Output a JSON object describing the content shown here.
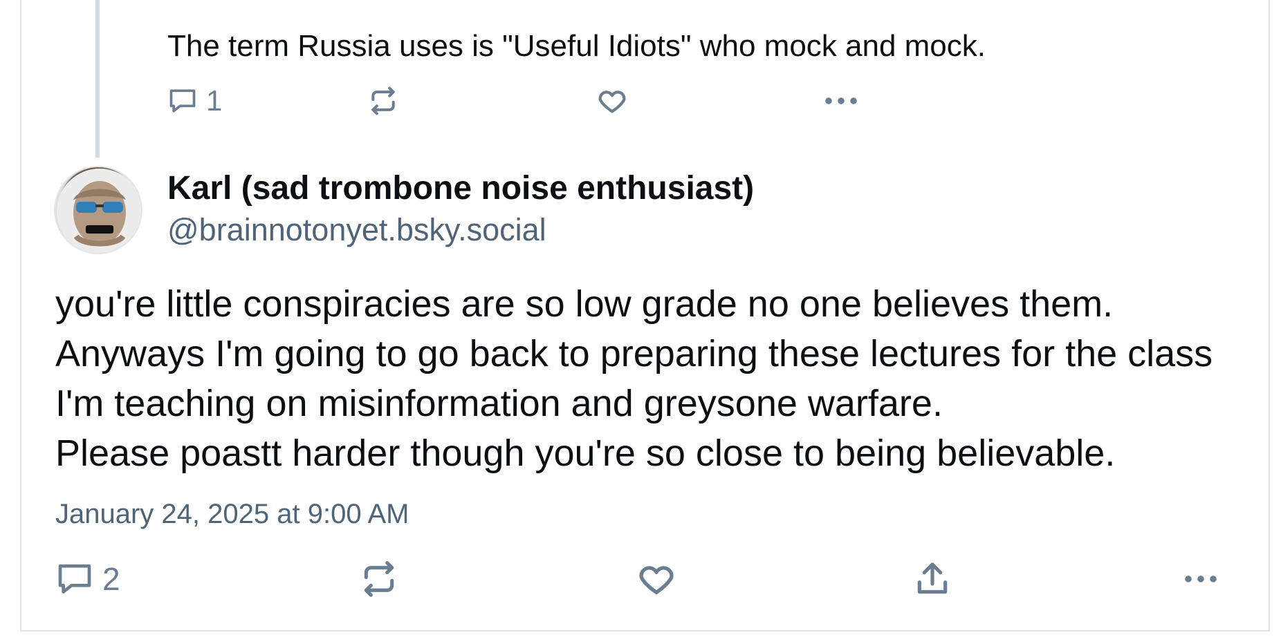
{
  "parent_post": {
    "text": "The term Russia uses is \"Useful Idiots\" who mock and mock.",
    "reply_count": "1",
    "icons": [
      "reply-icon",
      "repost-icon",
      "like-icon",
      "more-icon"
    ]
  },
  "post": {
    "author": {
      "display_name": "Karl (sad trombone noise enthusiast)",
      "handle": "@brainnotonyet.bsky.social"
    },
    "text": "you're little conspiracies are so low grade no one believes them.\nAnyways I'm going to go back to preparing  these lectures for the class I'm teaching on misinformation and greysone warfare.\nPlease poastt harder though you're so close to being believable.",
    "timestamp": "January 24, 2025 at 9:00 AM",
    "reply_count": "2",
    "icons": [
      "reply-icon",
      "repost-icon",
      "like-icon",
      "share-icon",
      "more-icon"
    ]
  },
  "colors": {
    "icon": "#6b7d90",
    "muted_text": "#4f6478",
    "thread_line": "#d4dbe3",
    "border": "#dfe3e8"
  }
}
